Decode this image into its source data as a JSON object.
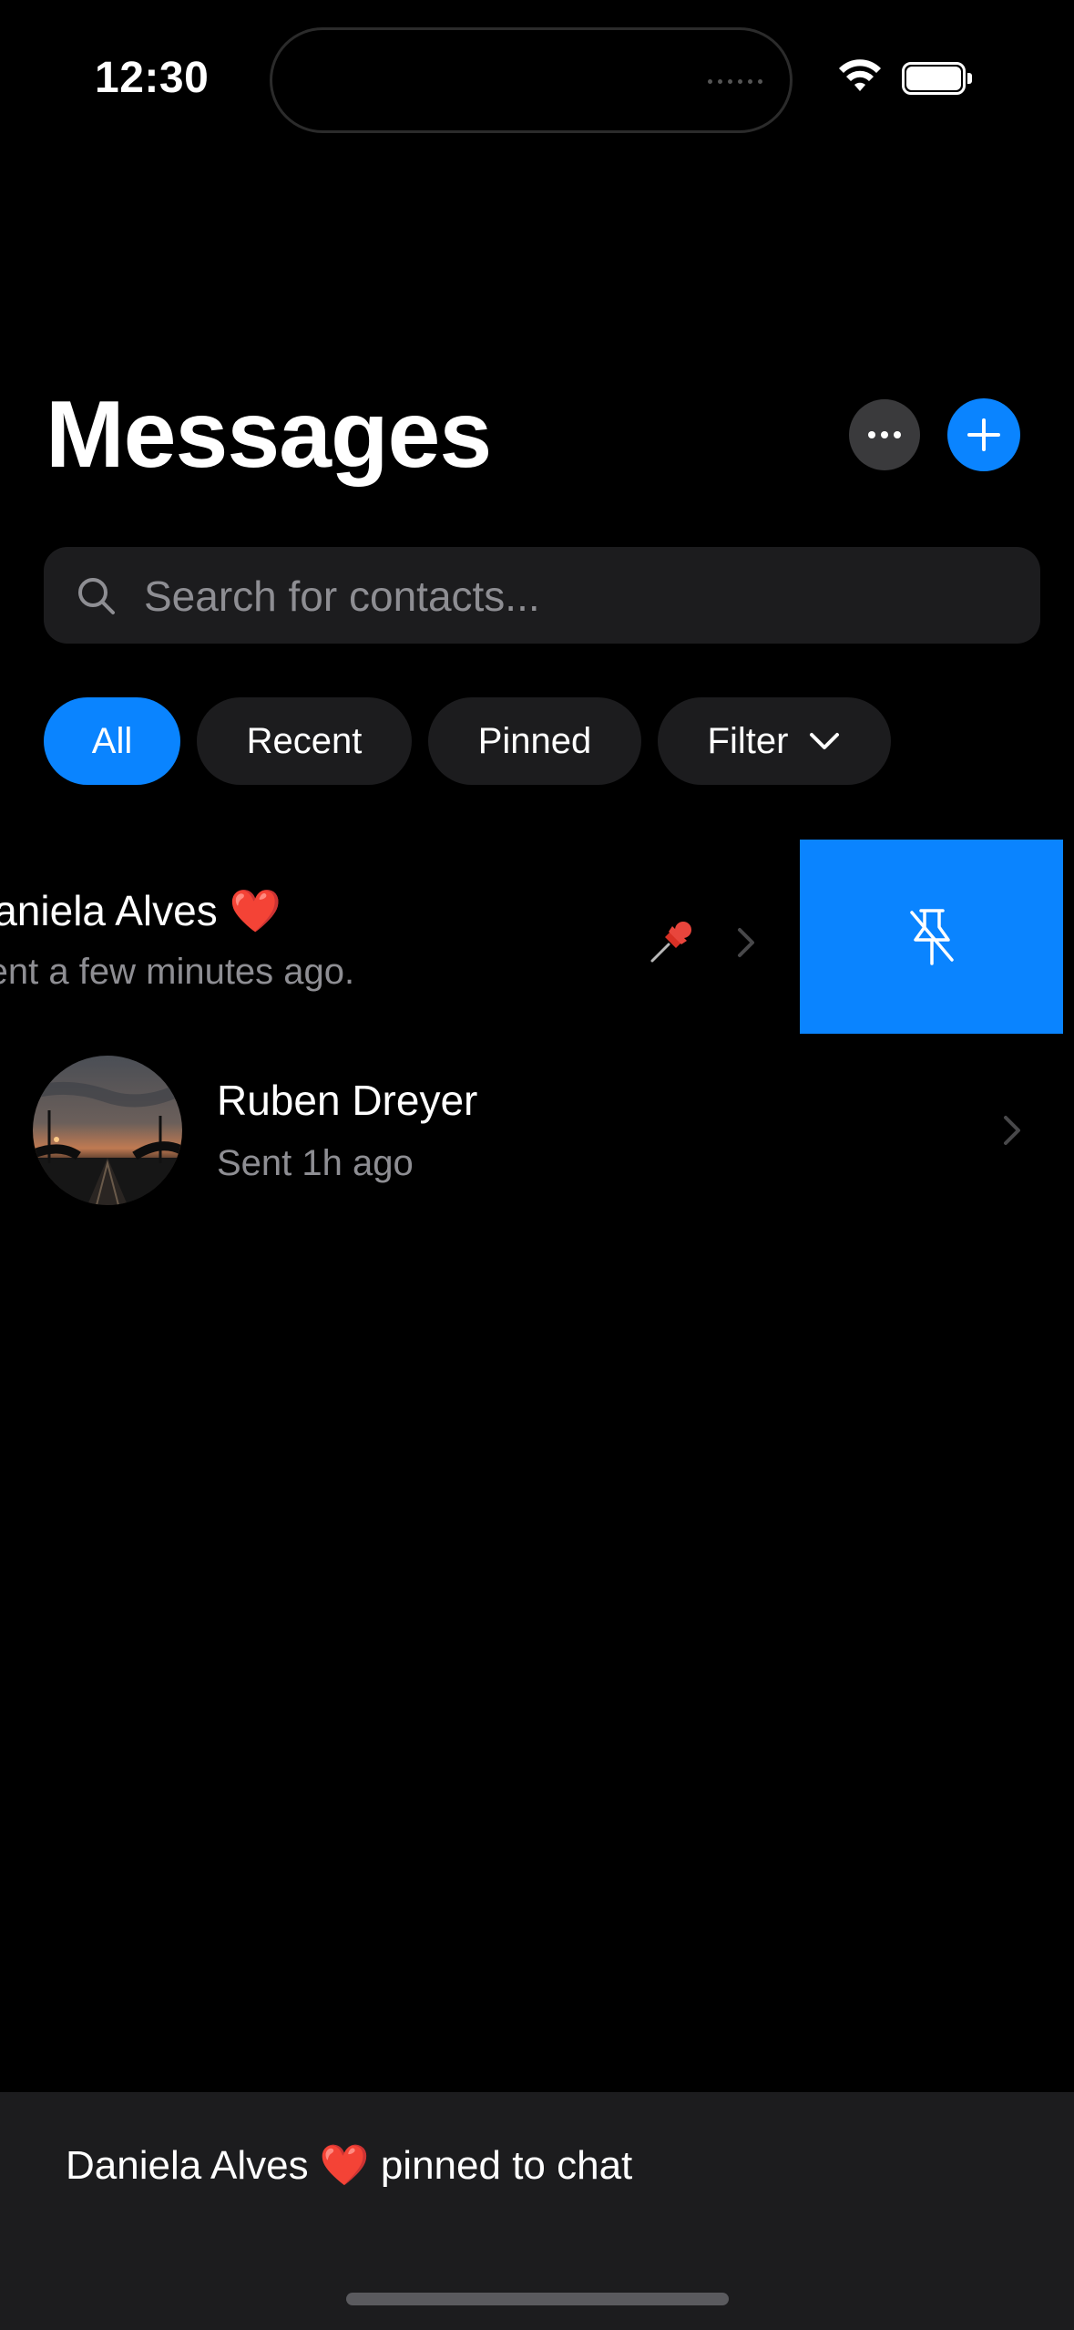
{
  "status_bar": {
    "time": "12:30"
  },
  "header": {
    "title": "Messages"
  },
  "search": {
    "placeholder": "Search for contacts..."
  },
  "filters": {
    "chips": [
      "All",
      "Recent",
      "Pinned",
      "Filter"
    ],
    "selected": "All"
  },
  "conversations": [
    {
      "name": "Daniela Alves ❤️",
      "subtitle": "Sent a few minutes ago.",
      "pinned": true
    },
    {
      "name": "Ruben Dreyer",
      "subtitle": "Sent 1h ago",
      "pinned": false
    }
  ],
  "toast": {
    "message": "Daniela Alves ❤️  pinned to chat"
  },
  "colors": {
    "accent": "#0a84ff",
    "background": "#000000",
    "surface": "#1c1c1e",
    "secondary_text": "#8e8e93"
  },
  "icons": [
    "wifi-icon",
    "battery-icon",
    "more-icon",
    "plus-icon",
    "search-icon",
    "chevron-down-icon",
    "pin-icon",
    "chevron-right-icon",
    "unpin-icon"
  ]
}
